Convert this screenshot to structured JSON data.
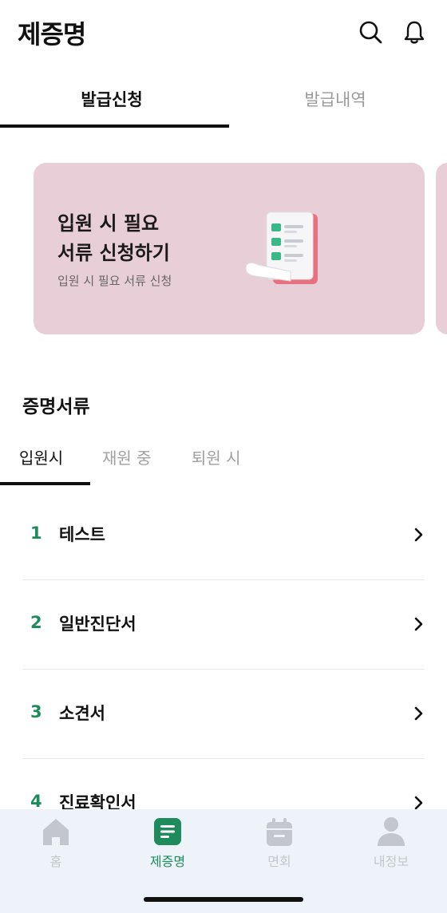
{
  "header": {
    "title": "제증명",
    "icons": [
      "search-icon",
      "bell-icon"
    ]
  },
  "tabs": [
    {
      "label": "발급신청",
      "active": true
    },
    {
      "label": "발급내역",
      "active": false
    }
  ],
  "banner": {
    "title_line1": "입원 시 필요",
    "title_line2": "서류 신청하기",
    "subtitle": "입원 시 필요 서류 신청",
    "background": "#e8ced6",
    "illustration": "document-checklist-icon"
  },
  "section": {
    "title": "증명서류",
    "subtabs": [
      {
        "label": "입원시",
        "active": true
      },
      {
        "label": "재원 중",
        "active": false
      },
      {
        "label": "퇴원 시",
        "active": false
      }
    ]
  },
  "documents": [
    {
      "num": "1",
      "label": "테스트"
    },
    {
      "num": "2",
      "label": "일반진단서"
    },
    {
      "num": "3",
      "label": "소견서"
    },
    {
      "num": "4",
      "label": "진료확인서"
    }
  ],
  "bottom_nav": [
    {
      "label": "홈",
      "icon": "home-icon",
      "active": false
    },
    {
      "label": "제증명",
      "icon": "document-icon",
      "active": true
    },
    {
      "label": "면회",
      "icon": "calendar-icon",
      "active": false
    },
    {
      "label": "내정보",
      "icon": "person-icon",
      "active": false
    }
  ],
  "colors": {
    "accent": "#1d8b5b",
    "nav_bg": "#eef3fa",
    "inactive": "#c3c7cd"
  }
}
